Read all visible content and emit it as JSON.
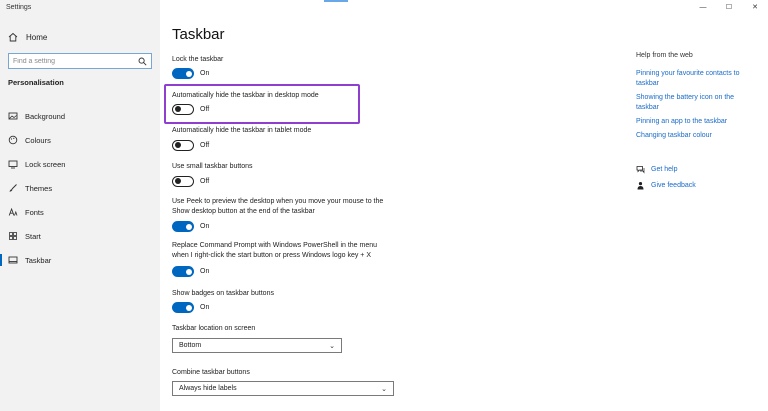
{
  "window": {
    "title": "Settings",
    "controls": {
      "minimize": "—",
      "maximize": "☐",
      "close": "✕"
    }
  },
  "sidebar": {
    "home_label": "Home",
    "search_placeholder": "Find a setting",
    "section_title": "Personalisation",
    "items": [
      {
        "label": "Background",
        "icon": "image-icon"
      },
      {
        "label": "Colours",
        "icon": "palette-icon"
      },
      {
        "label": "Lock screen",
        "icon": "lock-screen-icon"
      },
      {
        "label": "Themes",
        "icon": "brush-icon"
      },
      {
        "label": "Fonts",
        "icon": "font-icon"
      },
      {
        "label": "Start",
        "icon": "start-icon"
      },
      {
        "label": "Taskbar",
        "icon": "taskbar-icon",
        "active": true
      }
    ]
  },
  "main": {
    "title": "Taskbar",
    "settings": [
      {
        "label": "Lock the taskbar",
        "state": "On"
      },
      {
        "label": "Automatically hide the taskbar in desktop mode",
        "state": "Off"
      },
      {
        "label": "Automatically hide the taskbar in tablet mode",
        "state": "Off"
      },
      {
        "label": "Use small taskbar buttons",
        "state": "Off"
      },
      {
        "label_line1": "Use Peek to preview the desktop when you move your mouse to the",
        "label_line2": "Show desktop button at the end of the taskbar",
        "state": "On"
      },
      {
        "label_line1": "Replace Command Prompt with Windows PowerShell in the menu",
        "label_line2": "when I right-click the start button or press Windows logo key + X",
        "state": "On"
      },
      {
        "label": "Show badges on taskbar buttons",
        "state": "On"
      }
    ],
    "location": {
      "label": "Taskbar location on screen",
      "value": "Bottom"
    },
    "combine": {
      "label": "Combine taskbar buttons",
      "value": "Always hide labels"
    }
  },
  "help": {
    "title": "Help from the web",
    "links": [
      {
        "line1": "Pinning your favourite contacts to",
        "line2": "taskbar"
      },
      {
        "line1": "Showing the battery icon on the",
        "line2": "taskbar"
      },
      {
        "line1": "Pinning an app to the taskbar",
        "line2": ""
      },
      {
        "line1": "Changing taskbar colour",
        "line2": ""
      }
    ],
    "get_help": "Get help",
    "give_feedback": "Give feedback"
  },
  "colors": {
    "accent": "#0067c0",
    "highlight_border": "#8e3fd0",
    "link": "#1a6bc8",
    "sidebar_bg": "#f2f2f2"
  }
}
